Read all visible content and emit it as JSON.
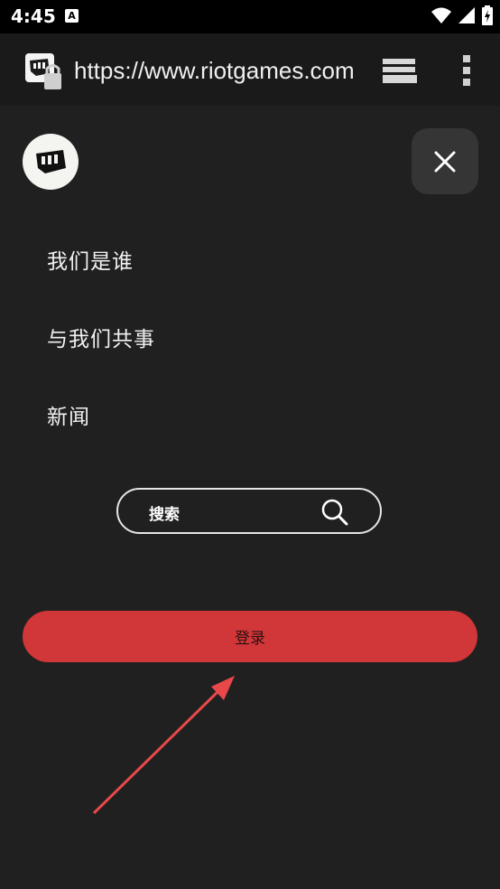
{
  "status_bar": {
    "time": "4:45",
    "notification_icon": "A",
    "icons": [
      "wifi-icon",
      "signal-icon",
      "battery-charging-icon"
    ]
  },
  "browser": {
    "url": "https://www.riotgames.com",
    "site_icon": "riot-fist-lock-icon",
    "tabs_icon": "tabs-icon",
    "menu_icon": "overflow-menu-icon"
  },
  "menu": {
    "logo": "riot-games-logo",
    "close_icon": "close-icon",
    "items": [
      {
        "label": "我们是谁"
      },
      {
        "label": "与我们共事"
      },
      {
        "label": "新闻"
      }
    ],
    "search": {
      "label": "搜索",
      "icon": "search-icon"
    },
    "login_label": "登录"
  },
  "colors": {
    "background": "#202020",
    "login_button": "#d13639",
    "arrow": "#e8484a"
  }
}
